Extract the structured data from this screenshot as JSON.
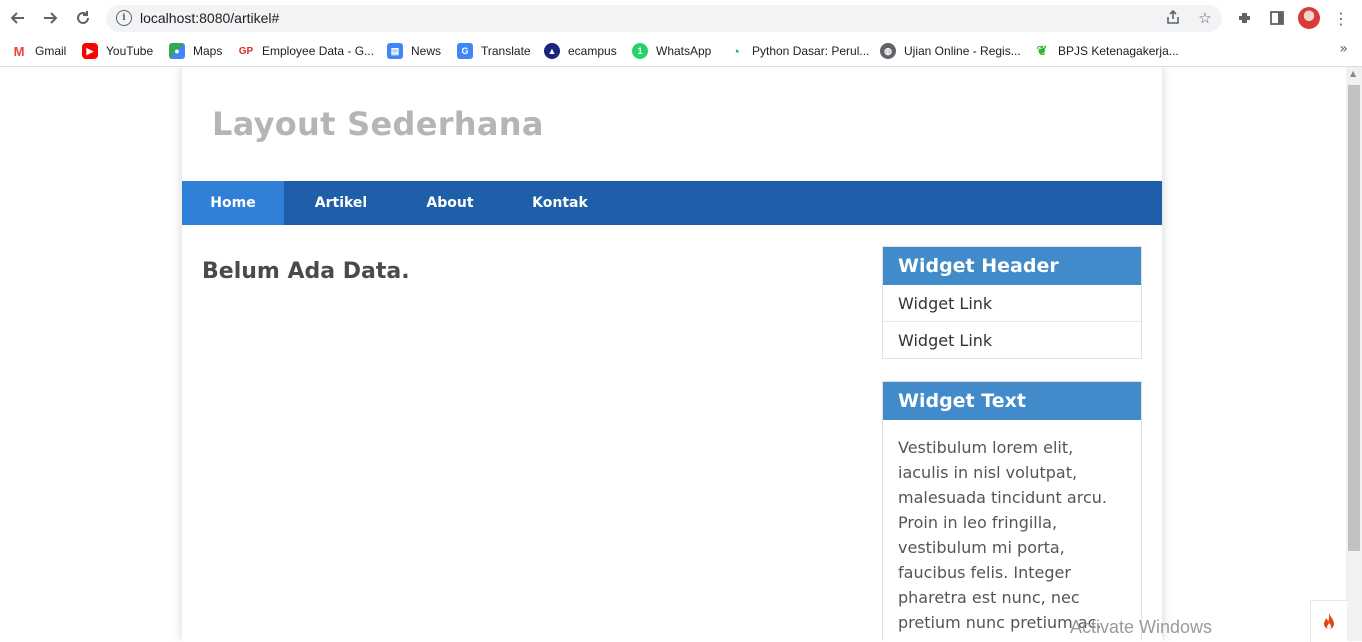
{
  "browser": {
    "url": "localhost:8080/artikel#",
    "bookmarks": [
      {
        "label": "Gmail",
        "icon": "gmail-icon",
        "color": "#ea4335"
      },
      {
        "label": "YouTube",
        "icon": "youtube-icon",
        "color": "#ff0000"
      },
      {
        "label": "Maps",
        "icon": "maps-icon",
        "color": "#34a853"
      },
      {
        "label": "Employee Data - G...",
        "icon": "employee-data-icon",
        "color": "#d93025"
      },
      {
        "label": "News",
        "icon": "news-icon",
        "color": "#4285f4"
      },
      {
        "label": "Translate",
        "icon": "translate-icon",
        "color": "#4285f4"
      },
      {
        "label": "ecampus",
        "icon": "ecampus-icon",
        "color": "#1a237e"
      },
      {
        "label": "WhatsApp",
        "icon": "whatsapp-icon",
        "color": "#25d366"
      },
      {
        "label": "Python Dasar: Perul...",
        "icon": "python-dasar-icon",
        "color": "#34a853"
      },
      {
        "label": "Ujian Online - Regis...",
        "icon": "globe-icon",
        "color": "#5f6368"
      },
      {
        "label": "BPJS Ketenagakerja...",
        "icon": "bpjs-icon",
        "color": "#2eb82e"
      }
    ]
  },
  "site": {
    "title": "Layout Sederhana",
    "nav": [
      {
        "label": "Home",
        "active": true
      },
      {
        "label": "Artikel",
        "active": false
      },
      {
        "label": "About",
        "active": false
      },
      {
        "label": "Kontak",
        "active": false
      }
    ],
    "content": {
      "heading": "Belum Ada Data."
    },
    "sidebar": {
      "widget_header": {
        "title": "Widget Header",
        "links": [
          "Widget Link",
          "Widget Link"
        ]
      },
      "widget_text": {
        "title": "Widget Text",
        "body": "Vestibulum lorem elit, iaculis in nisl volutpat, malesuada tincidunt arcu. Proin in leo fringilla, vestibulum mi porta, faucibus felis. Integer pharetra est nunc, nec pretium nunc pretium ac."
      }
    }
  },
  "os": {
    "watermark": "Activate Windows"
  },
  "colors": {
    "nav_bg": "#1f5fa9",
    "nav_active": "#2f80d6",
    "widget_head": "#428bca",
    "title_gray": "#b5b5b5"
  }
}
